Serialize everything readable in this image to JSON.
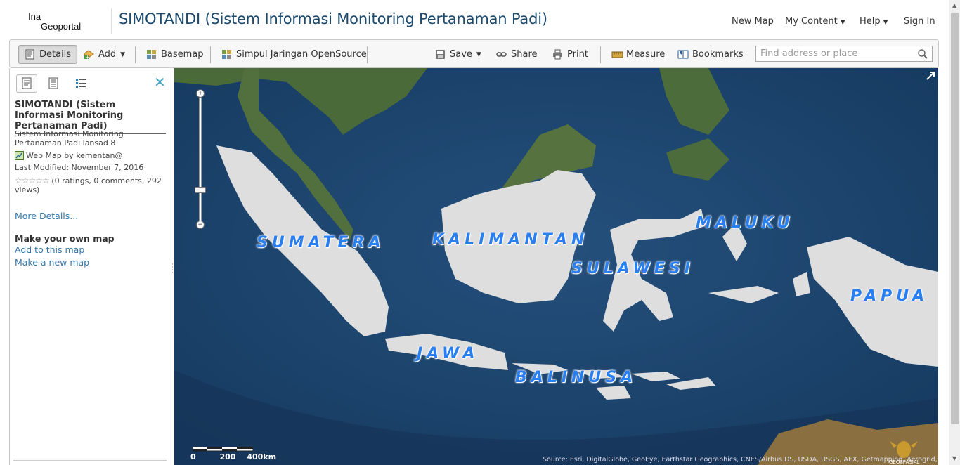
{
  "header": {
    "logo_line1": "Ina",
    "logo_line2": "Geoportal",
    "app_title": "SIMOTANDI (Sistem Informasi Monitoring Pertanaman Padi)",
    "nav": {
      "new_map": "New Map",
      "my_content": "My Content",
      "help": "Help",
      "sign_in": "Sign In"
    }
  },
  "toolbar": {
    "details": "Details",
    "add": "Add",
    "basemap": "Basemap",
    "simpul": "Simpul Jaringan OpenSource",
    "save": "Save",
    "share": "Share",
    "print": "Print",
    "measure": "Measure",
    "bookmarks": "Bookmarks",
    "search_placeholder": "Find address or place"
  },
  "sidebar": {
    "title": "SIMOTANDI (Sistem Informasi Monitoring Pertanaman Padi)",
    "description": "Sistem Informasi Monitoring Pertanaman Padi lansad 8",
    "web_map_by": "Web Map by",
    "owner": "kementan@",
    "last_modified": "Last Modified: November 7, 2016",
    "ratings": "(0 ratings, 0 comments, 292 views)",
    "more_details": "More Details...",
    "make_map_heading": "Make your own map",
    "add_to_map": "Add to this map",
    "make_new_map": "Make a new map"
  },
  "map": {
    "labels": {
      "sumatera": "SUMATERA",
      "kalimantan": "KALIMANTAN",
      "sulawesi": "SULAWESI",
      "maluku": "MALUKU",
      "papua": "PAPUA",
      "jawa": "JAWA",
      "balinusa": "BALINUSA"
    },
    "scale": {
      "s0": "0",
      "s1": "200",
      "s2": "400km"
    },
    "attribution": "Source: Esri, DigitalGlobe, GeoEye, Earthstar Geographics, CNES/Airbus DS, USDA, USGS, AEX, Getmapping, Aerogrid, IGN, IGP, swisstopo, and the GIS User Community",
    "logo_text": "GEOSPASIAL UNTUK NEGERI"
  },
  "colors": {
    "accent": "#3577a8",
    "title": "#1d4b6e",
    "region_label": "#2a7ff0",
    "land_highlight": "#dedede",
    "ocean": "#1e4770"
  }
}
